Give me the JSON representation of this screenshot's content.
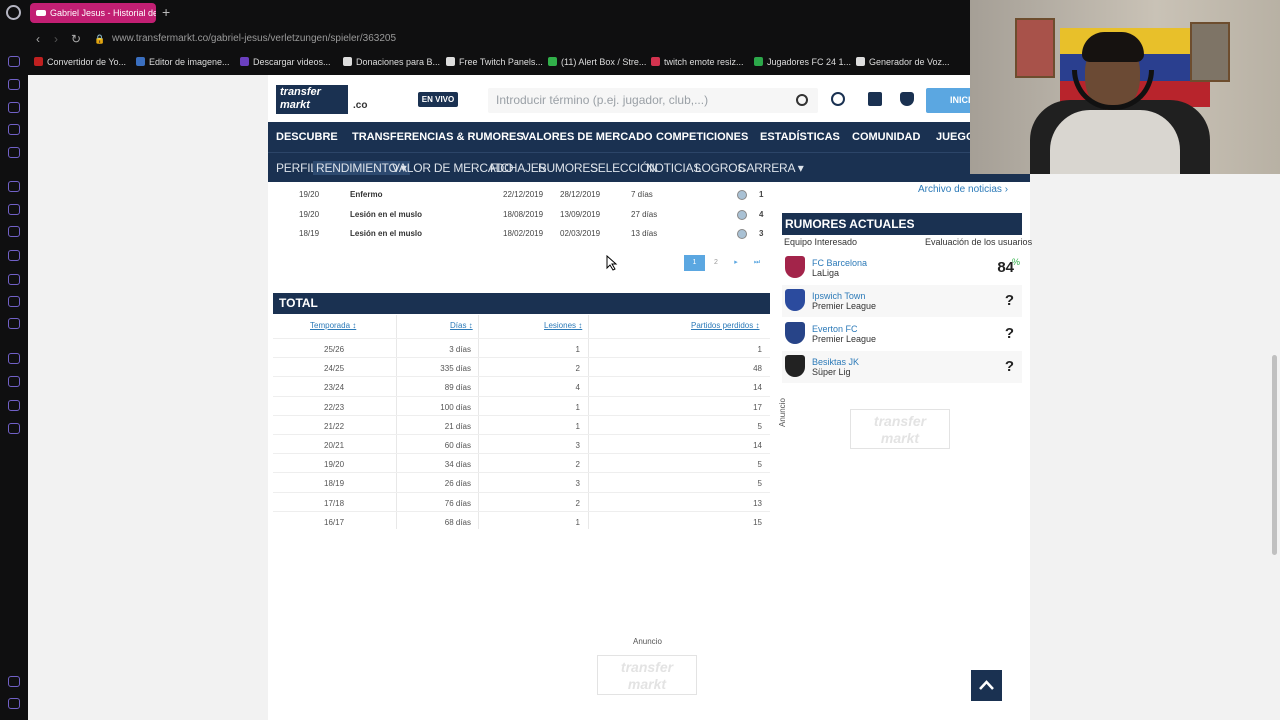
{
  "browser": {
    "tab_title": "Gabriel Jesus - Historial de",
    "new_tab": "+",
    "url": "www.transfermarkt.co/gabriel-jesus/verletzungen/spieler/363205",
    "bookmarks": [
      {
        "label": "Convertidor de Yo...",
        "color": "#c02020"
      },
      {
        "label": "Editor de imagene...",
        "color": "#3a6fc0"
      },
      {
        "label": "Descargar videos...",
        "color": "#6a3fbf"
      },
      {
        "label": "Donaciones para B...",
        "color": "#dddddd"
      },
      {
        "label": "Free Twitch Panels...",
        "color": "#dddddd"
      },
      {
        "label": "(11) Alert Box / Stre...",
        "color": "#31b04a"
      },
      {
        "label": "twitch emote resiz...",
        "color": "#d3334f"
      },
      {
        "label": "Jugadores FC 24 1...",
        "color": "#2ca84a"
      },
      {
        "label": "Generador de Voz...",
        "color": "#dddddd"
      }
    ]
  },
  "header": {
    "logo_line1": "transfer",
    "logo_line2": "markt",
    "logo_tld": ".co",
    "live_label": "EN VIVO",
    "search_placeholder": "Introducir término (p.ej. jugador, club,...)",
    "login_label": "INICI"
  },
  "main_nav": [
    "DESCUBRE",
    "TRANSFERENCIAS & RUMORES",
    "VALORES DE MERCADO",
    "COMPETICIONES",
    "ESTADÍSTICAS",
    "COMUNIDAD",
    "JUEGO"
  ],
  "sub_nav": [
    "PERFIL",
    "RENDIMIENTO ▾",
    "VALOR DE MERCADO",
    "FICHAJES",
    "RUMORES",
    "SELECCIÓN",
    "NOTICIAS",
    "LOGROS",
    "CARRERA ▾"
  ],
  "injuries": [
    {
      "season": "19/20",
      "type": "Enfermo",
      "from": "22/12/2019",
      "until": "28/12/2019",
      "days": "7 días",
      "games": "1"
    },
    {
      "season": "19/20",
      "type": "Lesión en el muslo",
      "from": "18/08/2019",
      "until": "13/09/2019",
      "days": "27 días",
      "games": "4"
    },
    {
      "season": "18/19",
      "type": "Lesión en el muslo",
      "from": "18/02/2019",
      "until": "02/03/2019",
      "days": "13 días",
      "games": "3"
    }
  ],
  "pagination": {
    "page1": "1",
    "page2": "2",
    "next": "▸",
    "last": "⏭"
  },
  "total": {
    "title": "TOTAL",
    "headers": {
      "season": "Temporada ↕",
      "days": "Días ↕",
      "injuries": "Lesiones ↕",
      "games_missed": "Partidos perdidos ↕"
    },
    "rows": [
      {
        "season": "25/26",
        "days": "3 días",
        "injuries": "1",
        "games": "1"
      },
      {
        "season": "24/25",
        "days": "335 días",
        "injuries": "2",
        "games": "48"
      },
      {
        "season": "23/24",
        "days": "89 días",
        "injuries": "4",
        "games": "14"
      },
      {
        "season": "22/23",
        "days": "100 días",
        "injuries": "1",
        "games": "17"
      },
      {
        "season": "21/22",
        "days": "21 días",
        "injuries": "1",
        "games": "5"
      },
      {
        "season": "20/21",
        "days": "60 días",
        "injuries": "3",
        "games": "14"
      },
      {
        "season": "19/20",
        "days": "34 días",
        "injuries": "2",
        "games": "5"
      },
      {
        "season": "18/19",
        "days": "26 días",
        "injuries": "3",
        "games": "5"
      },
      {
        "season": "17/18",
        "days": "76 días",
        "injuries": "2",
        "games": "13"
      },
      {
        "season": "16/17",
        "days": "68 días",
        "injuries": "1",
        "games": "15"
      }
    ]
  },
  "rumors": {
    "archive_link": "Archivo de noticias ›",
    "title": "RUMORES ACTUALES",
    "col_interested": "Equipo Interesado",
    "col_rating": "Evaluación de los usuarios",
    "items": [
      {
        "club": "FC Barcelona",
        "league": "LaLiga",
        "rating": "84",
        "unit": "%",
        "crest": "#a3244a"
      },
      {
        "club": "Ipswich Town",
        "league": "Premier League",
        "rating": "?",
        "unit": "",
        "crest": "#2b4b9e"
      },
      {
        "club": "Everton FC",
        "league": "Premier League",
        "rating": "?",
        "unit": "",
        "crest": "#274488"
      },
      {
        "club": "Besiktas JK",
        "league": "Süper Lig",
        "rating": "?",
        "unit": "",
        "crest": "#222222"
      }
    ]
  },
  "ads": {
    "side_label": "Anuncio",
    "bottom_label": "Anuncio"
  },
  "colors": {
    "brand": "#1a3151",
    "link": "#2c7ab8",
    "tab": "#c21f73"
  }
}
